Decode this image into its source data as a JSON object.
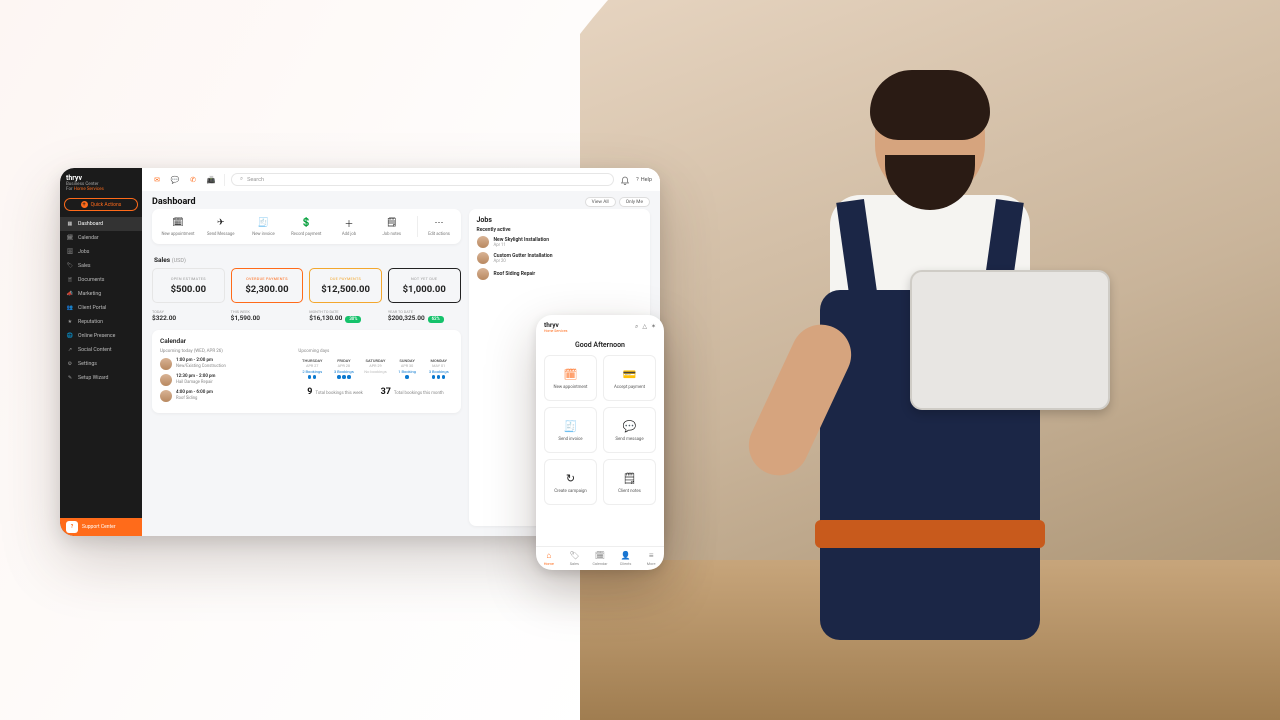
{
  "brand": {
    "name": "thryv",
    "sub1": "Business Center",
    "sub2_prefix": "For ",
    "sub2_orange": "Home Services"
  },
  "sidebar": {
    "quick_actions": "Quick Actions",
    "items": [
      {
        "icon": "grid",
        "label": "Dashboard",
        "active": true
      },
      {
        "icon": "calendar",
        "label": "Calendar"
      },
      {
        "icon": "briefcase",
        "label": "Jobs"
      },
      {
        "icon": "tag",
        "label": "Sales"
      },
      {
        "icon": "file",
        "label": "Documents"
      },
      {
        "icon": "megaphone",
        "label": "Marketing"
      },
      {
        "icon": "users",
        "label": "Client Portal"
      },
      {
        "icon": "star",
        "label": "Reputation"
      },
      {
        "icon": "globe",
        "label": "Online Presence"
      },
      {
        "icon": "share",
        "label": "Social Content"
      },
      {
        "icon": "gear",
        "label": "Settings"
      },
      {
        "icon": "wand",
        "label": "Setup Wizard"
      }
    ],
    "support": "Support Center"
  },
  "topbar": {
    "icons": [
      "mail",
      "chat",
      "phone",
      "fax"
    ],
    "search_placeholder": "Search",
    "help": "Help"
  },
  "dashboard": {
    "title": "Dashboard",
    "view_all": "View All",
    "only_me": "Only Me",
    "actions": [
      {
        "icon": "calendar",
        "label": "New appointment"
      },
      {
        "icon": "send",
        "label": "Send Message"
      },
      {
        "icon": "invoice",
        "label": "New invoice"
      },
      {
        "icon": "cash",
        "label": "Record payment"
      },
      {
        "icon": "addjob",
        "label": "Add job"
      },
      {
        "icon": "note",
        "label": "Job notes"
      }
    ],
    "edit_actions": "Edit actions",
    "sales": {
      "title": "Sales",
      "currency": "(USD)",
      "cards": [
        {
          "label": "OPEN ESTIMATES",
          "value": "$500.00",
          "type": ""
        },
        {
          "label": "OVERDUE PAYMENTS",
          "value": "$2,300.00",
          "type": "overdue"
        },
        {
          "label": "DUE PAYMENTS",
          "value": "$12,500.00",
          "type": "due"
        },
        {
          "label": "NOT YET DUE",
          "value": "$1,000.00",
          "type": "nyd"
        }
      ],
      "periods": [
        {
          "label": "TODAY",
          "value": "$322.00",
          "badge": ""
        },
        {
          "label": "THIS WEEK",
          "value": "$1,590.00",
          "badge": ""
        },
        {
          "label": "MONTH TO DATE",
          "value": "$16,130.00",
          "badge": "30%"
        },
        {
          "label": "YEAR TO DATE",
          "value": "$200,325.00",
          "badge": "62%"
        }
      ]
    },
    "calendar": {
      "title": "Calendar",
      "today_label": "Upcoming today (WED, APR 26)",
      "events": [
        {
          "time": "1:00 pm - 2:00 pm",
          "desc": "New/Existing Construction"
        },
        {
          "time": "12:30 pm - 2:00 pm",
          "desc": "Hail Damage Repair"
        },
        {
          "time": "4:00 pm - 6:00 pm",
          "desc": "Roof Siding"
        }
      ],
      "upcoming_label": "Upcoming days",
      "days": [
        {
          "dow": "THURSDAY",
          "date": "APR 27",
          "bookings": "2 Bookings",
          "dots": 2
        },
        {
          "dow": "FRIDAY",
          "date": "APR 28",
          "bookings": "3 Bookings",
          "dots": 3
        },
        {
          "dow": "SATURDAY",
          "date": "APR 29",
          "bookings": "No bookings",
          "dots": 0
        },
        {
          "dow": "SUNDAY",
          "date": "APR 30",
          "bookings": "1 Booking",
          "dots": 1
        },
        {
          "dow": "MONDAY",
          "date": "MAY 01",
          "bookings": "3 Bookings",
          "dots": 3
        }
      ],
      "total_week_n": "9",
      "total_week": "Total bookings this week",
      "total_month_n": "37",
      "total_month": "Total bookings this month"
    },
    "jobs": {
      "title": "Jobs",
      "sub": "Recently active",
      "items": [
        {
          "title": "New Skylight Installation",
          "date": "Apr 11"
        },
        {
          "title": "Custom Gutter Installation",
          "date": "Apr 20"
        },
        {
          "title": "Roof Siding Repair",
          "date": ""
        }
      ]
    }
  },
  "mobile": {
    "greeting": "Good Afternoon",
    "cards": [
      {
        "icon": "calendar",
        "label": "New appointment",
        "orange": true
      },
      {
        "icon": "card",
        "label": "Accept payment",
        "orange": false
      },
      {
        "icon": "invoice",
        "label": "Send invoice",
        "orange": true
      },
      {
        "icon": "chat",
        "label": "Send message",
        "orange": false
      },
      {
        "icon": "refresh",
        "label": "Create campaign",
        "orange": false
      },
      {
        "icon": "note",
        "label": "Client notes",
        "orange": false
      }
    ],
    "nav": [
      {
        "icon": "home",
        "label": "Home",
        "active": true
      },
      {
        "icon": "tag",
        "label": "Sales"
      },
      {
        "icon": "calendar",
        "label": "Calendar"
      },
      {
        "icon": "user",
        "label": "Clients"
      },
      {
        "icon": "menu",
        "label": "More"
      }
    ]
  }
}
